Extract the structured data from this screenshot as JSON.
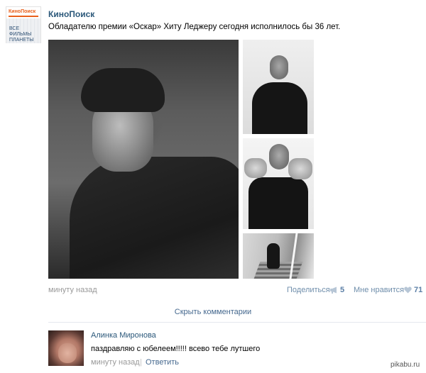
{
  "post": {
    "logo": {
      "brand": "КиноПоиск",
      "lines": [
        "ВСЕ",
        "ФИЛЬМЫ",
        "ПЛАНЕТЫ"
      ]
    },
    "author": "КиноПоиск",
    "text": "Обладателю премии «Оскар» Хиту Леджеру сегодня исполнилось бы 36 лет.",
    "time": "минуту назад",
    "share_label": "Поделиться",
    "share_count": "5",
    "like_label": "Мне нравится",
    "like_count": "71"
  },
  "comments": {
    "hide_label": "Скрыть комментарии",
    "items": [
      {
        "author": "Алинка Миронова",
        "text": "паздравляю с юбелеем!!!!! всево тебе лутшего",
        "time": "минуту назад",
        "separator": "|",
        "reply_label": "Ответить"
      }
    ]
  },
  "watermark": "pikabu.ru",
  "colors": {
    "link": "#2b587a",
    "accent": "#45688e",
    "muted": "#999999"
  },
  "icons": {
    "share": "megaphone-icon",
    "like": "heart-icon"
  }
}
